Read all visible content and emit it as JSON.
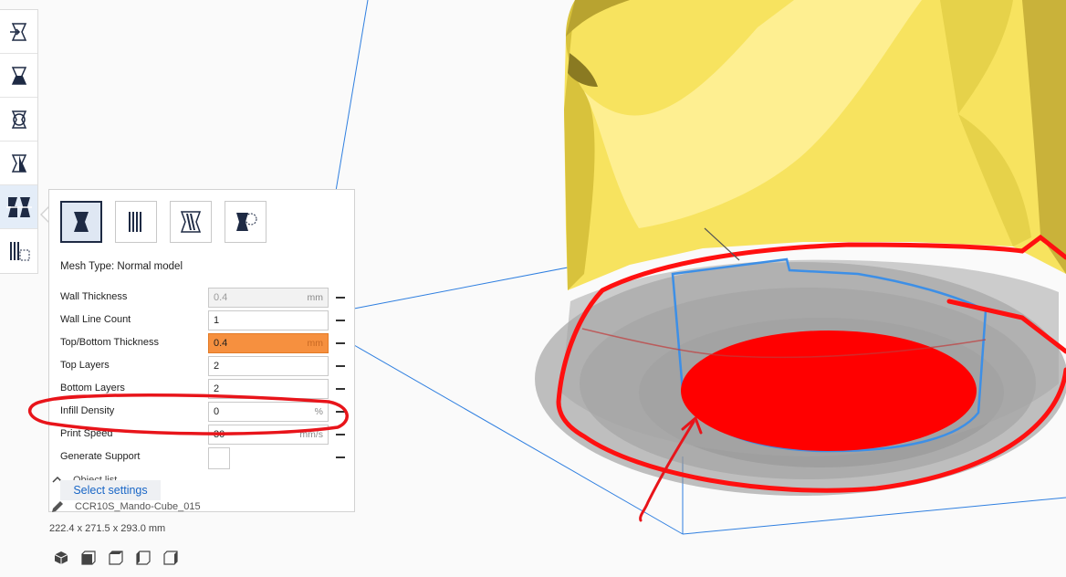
{
  "toolbar": {
    "tools": [
      {
        "icon": "move-tool-icon"
      },
      {
        "icon": "scale-tool-icon"
      },
      {
        "icon": "rotate-tool-icon"
      },
      {
        "icon": "mirror-tool-icon"
      },
      {
        "icon": "per-model-settings-icon",
        "active": true
      },
      {
        "icon": "support-blocker-icon"
      }
    ]
  },
  "mesh_types": [
    {
      "icon": "normal-model-icon",
      "selected": true
    },
    {
      "icon": "print-as-support-icon"
    },
    {
      "icon": "modify-overlap-settings-icon"
    },
    {
      "icon": "dont-support-overlaps-icon"
    }
  ],
  "mesh_type_label": "Mesh Type: Normal model",
  "settings": {
    "wall_thickness": {
      "label": "Wall Thickness",
      "value": "0.4",
      "unit": "mm"
    },
    "wall_line_count": {
      "label": "Wall Line Count",
      "value": "1",
      "unit": ""
    },
    "top_bottom_thickness": {
      "label": "Top/Bottom Thickness",
      "value": "0.4",
      "unit": "mm"
    },
    "top_layers": {
      "label": "Top Layers",
      "value": "2",
      "unit": ""
    },
    "bottom_layers": {
      "label": "Bottom Layers",
      "value": "2",
      "unit": ""
    },
    "infill_density": {
      "label": "Infill Density",
      "value": "0",
      "unit": "%"
    },
    "print_speed": {
      "label": "Print Speed",
      "value": "30",
      "unit": "mm/s"
    },
    "generate_support": {
      "label": "Generate Support"
    }
  },
  "select_settings_label": "Select settings",
  "object_list_label": "Object list",
  "object_name": "CCR10S_Mando-Cube_015",
  "dimensions": "222.4 x 271.5 x 293.0 mm",
  "view_buttons": [
    "3d-view-icon",
    "front-view-icon",
    "top-view-icon",
    "left-view-icon",
    "right-view-icon"
  ],
  "colors": {
    "accent": "#1966c6",
    "warning": "#f6903f",
    "model": "#f7e35f",
    "annotation": "#e8141a",
    "outline": "#3d8fe6"
  }
}
